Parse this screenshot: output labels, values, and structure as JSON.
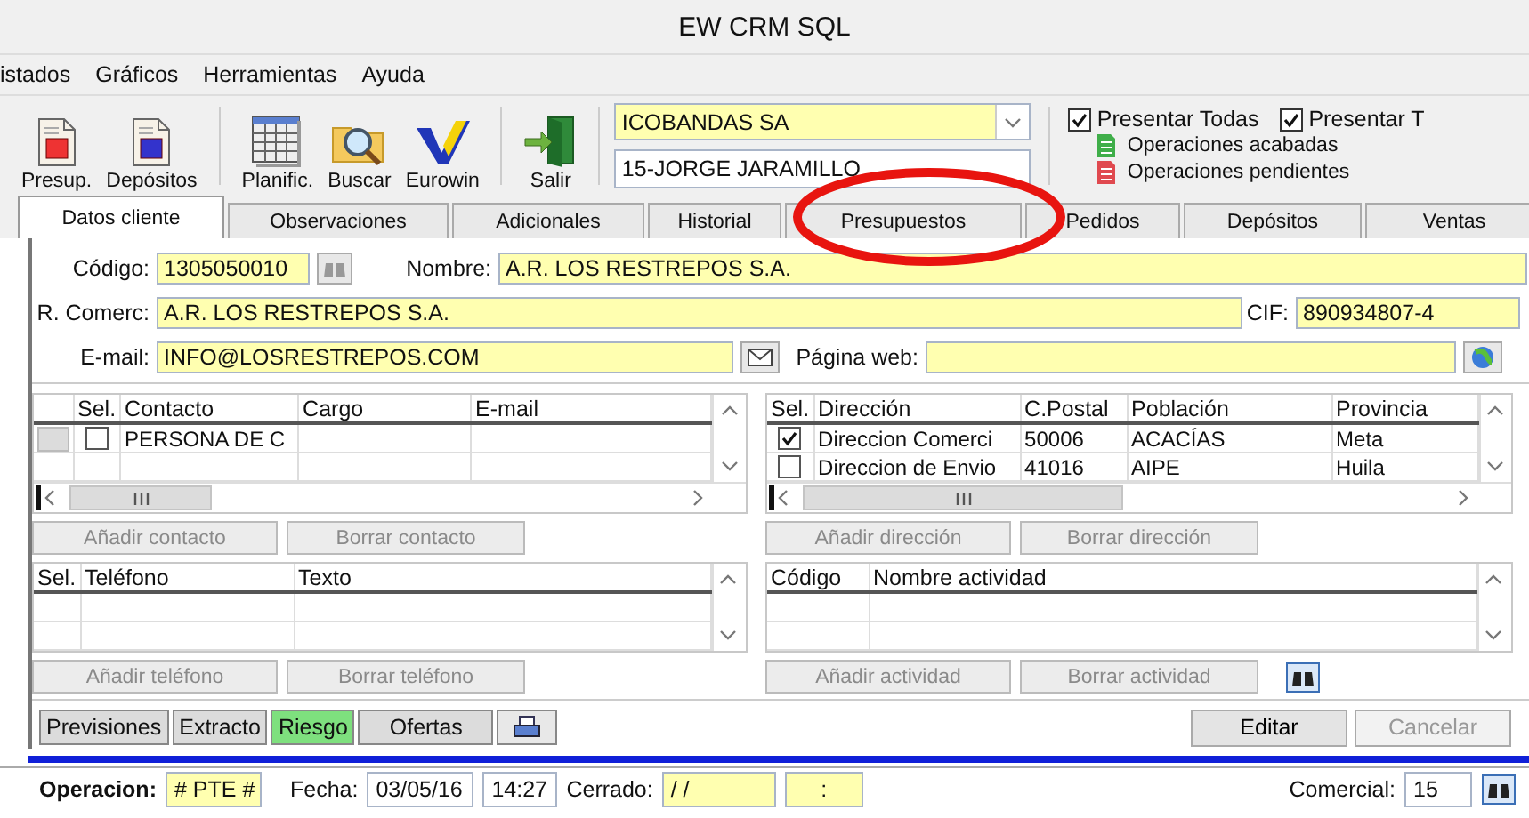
{
  "window": {
    "title": "EW CRM SQL"
  },
  "menu": [
    "istados",
    "Gráficos",
    "Herramientas",
    "Ayuda"
  ],
  "toolbar": [
    {
      "label": "Presup.",
      "kind": "budget"
    },
    {
      "label": "Depósitos",
      "kind": "deposit"
    },
    {
      "label": "Planific.",
      "kind": "planner"
    },
    {
      "label": "Buscar",
      "kind": "search"
    },
    {
      "label": "Eurowin",
      "kind": "logo"
    },
    {
      "label": "Salir",
      "kind": "exit"
    }
  ],
  "customer_selector": {
    "value": "ICOBANDAS SA"
  },
  "agent_field": {
    "value": "15-JORGE JARAMILLO"
  },
  "filters": [
    {
      "label": "Presentar Todas",
      "checked": true
    },
    {
      "label": "Presentar T",
      "checked": true
    }
  ],
  "legend": [
    {
      "label": "Operaciones acabadas",
      "color": "#3fae49"
    },
    {
      "label": "Operaciones pendientes",
      "color": "#e0494f"
    }
  ],
  "tabs": [
    {
      "label": "Datos cliente",
      "selected": true
    },
    {
      "label": "Observaciones",
      "selected": false
    },
    {
      "label": "Adicionales",
      "selected": false
    },
    {
      "label": "Historial",
      "selected": false
    },
    {
      "label": "Presupuestos",
      "selected": false
    },
    {
      "label": "Pedidos",
      "selected": false
    },
    {
      "label": "Depósitos",
      "selected": false
    },
    {
      "label": "Ventas",
      "selected": false
    }
  ],
  "form": {
    "code": {
      "label": "Código:",
      "value": "1305050010"
    },
    "name": {
      "label": "Nombre:",
      "value": "A.R. LOS RESTREPOS S.A."
    },
    "trade_name": {
      "label": "R. Comerc:",
      "value": "A.R. LOS RESTREPOS S.A."
    },
    "tax_id": {
      "label": "CIF:",
      "value": "890934807-4"
    },
    "email": {
      "label": "E-mail:",
      "value": "INFO@LOSRESTREPOS.COM"
    },
    "website": {
      "label": "Página web:"
    }
  },
  "contacts": {
    "check_column": "Sel.",
    "columns": [
      "Contacto",
      "Cargo",
      "E-mail"
    ],
    "rows": [
      {
        "checked": false,
        "cells": [
          "PERSONA DE C",
          "",
          ""
        ]
      }
    ],
    "buttons": [
      {
        "label": "Añadir contacto",
        "disabled": true
      },
      {
        "label": "Borrar contacto",
        "disabled": true
      }
    ]
  },
  "addresses": {
    "check_column": "Sel.",
    "columns": [
      "Dirección",
      "C.Postal",
      "Población",
      "Provincia"
    ],
    "rows": [
      {
        "checked": true,
        "cells": [
          "Direccion Comerci",
          "50006",
          "ACACÍAS",
          "Meta"
        ]
      },
      {
        "checked": false,
        "cells": [
          "Direccion de Envio",
          "41016",
          "AIPE",
          "Huila"
        ]
      }
    ],
    "buttons": [
      {
        "label": "Añadir dirección",
        "disabled": true
      },
      {
        "label": "Borrar dirección",
        "disabled": true
      }
    ]
  },
  "phones": {
    "check_column": "Sel.",
    "columns": [
      "Teléfono",
      "Texto"
    ],
    "buttons": [
      {
        "label": "Añadir teléfono",
        "disabled": true
      },
      {
        "label": "Borrar teléfono",
        "disabled": true
      }
    ]
  },
  "activities": {
    "columns": [
      "Código",
      "Nombre actividad"
    ],
    "buttons": [
      {
        "label": "Añadir actividad",
        "disabled": true
      },
      {
        "label": "Borrar actividad",
        "disabled": true
      }
    ]
  },
  "action_buttons": [
    {
      "label": "Previsiones",
      "color": "#dcdcdc"
    },
    {
      "label": "Extracto",
      "color": "#dcdcdc"
    },
    {
      "label": "Riesgo",
      "color": "#7ee07e"
    },
    {
      "label": "Ofertas",
      "color": "#dcdcdc"
    }
  ],
  "edit_buttons": [
    {
      "label": "Editar",
      "disabled": false
    },
    {
      "label": "Cancelar",
      "disabled": true
    }
  ],
  "status": {
    "operation": {
      "label": "Operacion:",
      "value": "# PTE #"
    },
    "date": {
      "label": "Fecha:",
      "value": "03/05/16",
      "time": "14:27"
    },
    "closed": {
      "label": "Cerrado:",
      "value": "/ /",
      "time": ":"
    },
    "agent": {
      "label": "Comercial:",
      "value": "15"
    }
  },
  "annotations": [
    {
      "kind": "ellipse",
      "color": "#e8140f"
    }
  ]
}
